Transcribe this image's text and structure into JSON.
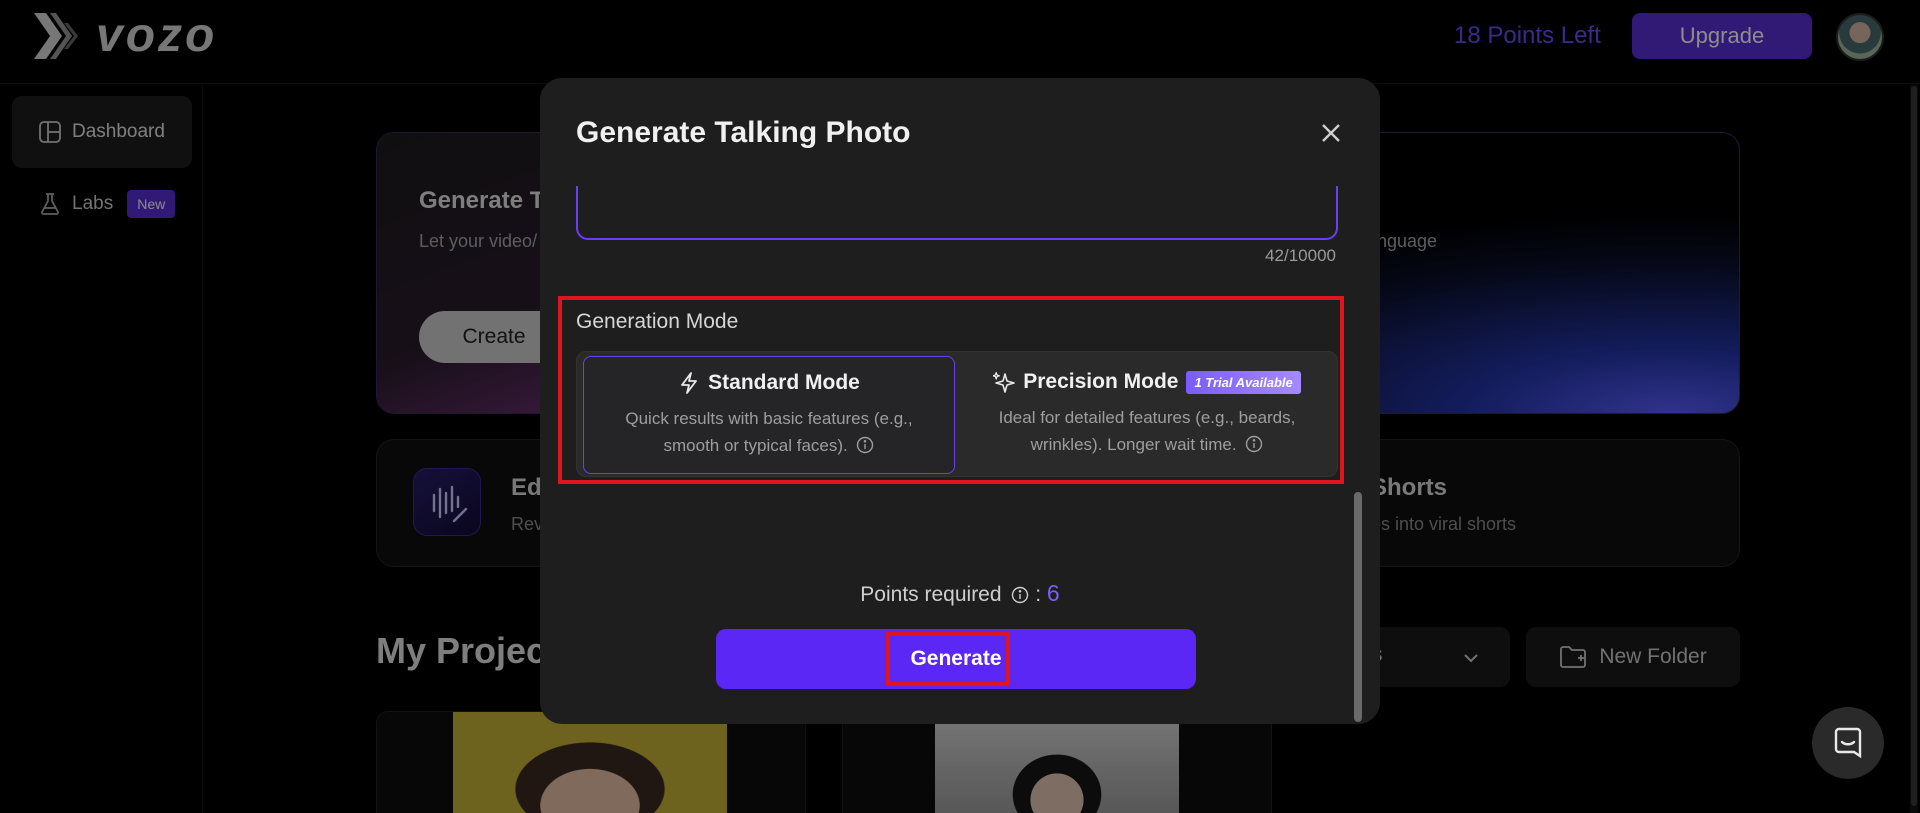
{
  "header": {
    "logo_text": "vozo",
    "points_left": "18 Points Left",
    "upgrade_label": "Upgrade"
  },
  "sidebar": {
    "items": [
      {
        "label": "Dashboard",
        "icon": "dashboard-icon"
      },
      {
        "label": "Labs",
        "icon": "flask-icon",
        "badge": "New"
      }
    ]
  },
  "main": {
    "hero": {
      "title_visible": "Generate T",
      "desc_left": "Let your video/",
      "desc_right": "nguage",
      "create_label": "Create"
    },
    "tools": [
      {
        "title_visible": "Ed",
        "desc_visible": "Rev"
      },
      {
        "title_visible": "Shorts",
        "desc_visible": "os into viral shorts"
      }
    ],
    "projects_title_visible": "My Projec",
    "sort_visible": "s",
    "new_folder_label": "New Folder"
  },
  "modal": {
    "title": "Generate Talking Photo",
    "char_count": "42/10000",
    "generation_mode_label": "Generation Mode",
    "modes": [
      {
        "name": "Standard Mode",
        "icon": "lightning-icon",
        "description": "Quick results with basic features (e.g., smooth or typical faces).",
        "selected": true
      },
      {
        "name": "Precision Mode",
        "icon": "sparkle-icon",
        "badge": "1 Trial Available",
        "description": "Ideal for detailed features (e.g., beards, wrinkles). Longer wait time.",
        "selected": false
      }
    ],
    "points_required_label": "Points required",
    "points_required_value": "6",
    "generate_label": "Generate"
  },
  "colors": {
    "accent": "#5b27f5",
    "highlight": "#e0141c",
    "points_text": "#6d4cff"
  }
}
